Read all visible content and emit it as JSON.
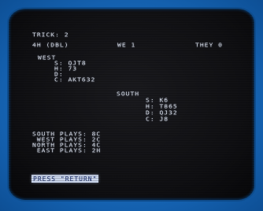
{
  "screen": {
    "trick": "TRICK: 2",
    "contract": "4H (DBL)",
    "we_score": "WE 1",
    "they_score": "THEY 0",
    "west": {
      "name": "WEST",
      "spades": "S: QJT8",
      "hearts": "H: 73",
      "diamonds": "D:",
      "clubs": "C: AKT632"
    },
    "south": {
      "name": "SOUTH",
      "spades": "S: K6",
      "hearts": "H: T865",
      "diamonds": "D: QJ32",
      "clubs": "C: J8"
    },
    "plays": [
      "SOUTH PLAYS: 8C",
      " WEST PLAYS: 2C",
      "NORTH PLAYS: 4C",
      " EAST PLAYS: 2H"
    ],
    "prompt": "PRESS \"RETURN\""
  },
  "colors": {
    "frame": "#1466b8",
    "screen": "#111114",
    "text": "#d8dde8",
    "prompt_bg": "#c9d4ea",
    "prompt_text": "#1a2c6a"
  }
}
